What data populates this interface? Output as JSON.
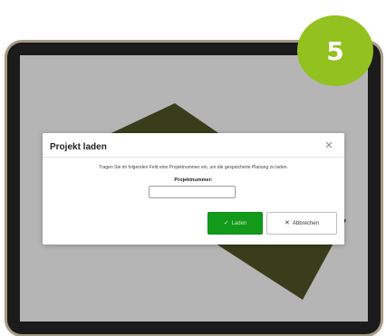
{
  "step_badge": {
    "number": "5",
    "color": "#93c11f"
  },
  "dialog": {
    "title": "Projekt laden",
    "close_icon": "close-icon",
    "instruction": "Tragen Sie im folgenden Feld eine Projektnummer ein, um die gespeicherte Planung zu laden.",
    "field_label": "Projektnummer:",
    "field_value": "",
    "field_placeholder": "",
    "load_button": {
      "label": "Laden",
      "icon": "check-icon",
      "color": "#129a1a"
    },
    "cancel_button": {
      "label": "Abbrechen",
      "icon": "close-icon"
    }
  },
  "colors": {
    "tablet_frame": "#1b1b1b",
    "screen_overlay": "#b5b5b5",
    "board": "#3a3d1c"
  }
}
